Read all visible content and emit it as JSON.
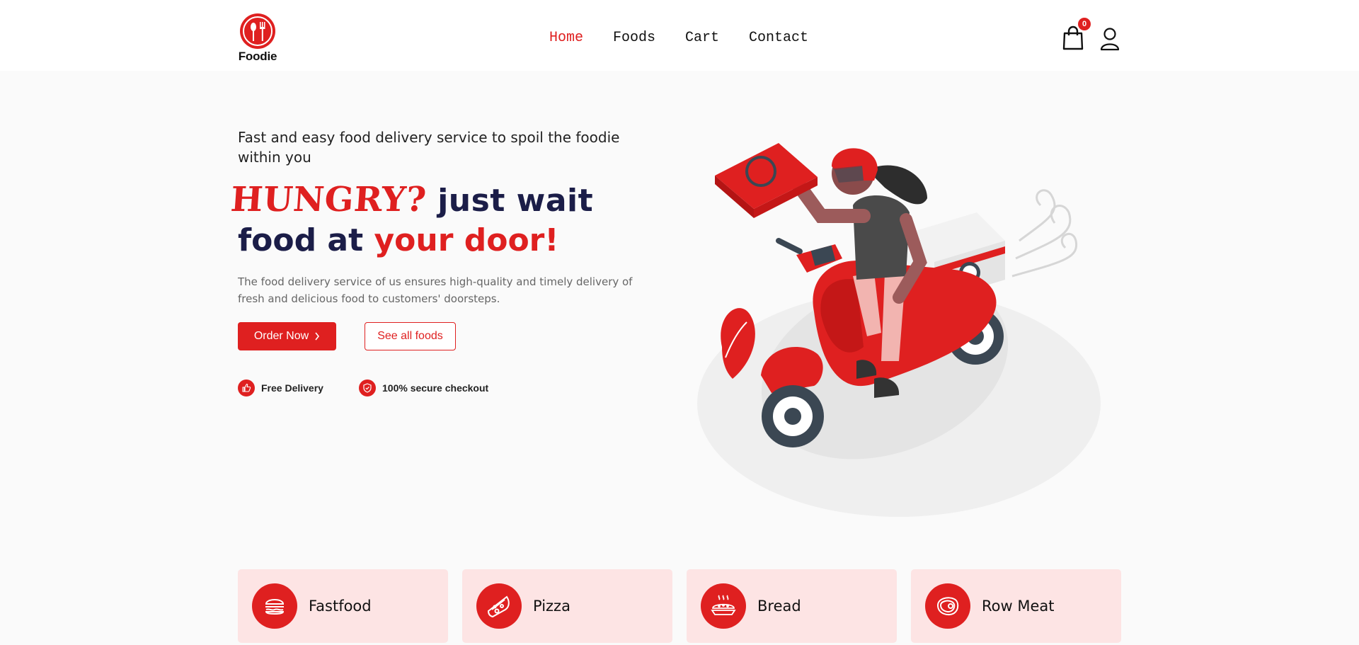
{
  "header": {
    "logo_text": "Foodie",
    "nav": [
      "Home",
      "Foods",
      "Cart",
      "Contact"
    ],
    "active_nav": "Home",
    "cart_count": "0",
    "icons": [
      "shopping-bag-icon",
      "user-icon"
    ]
  },
  "hero": {
    "subtitle": "Fast and easy food delivery service to spoil the foodie within you",
    "headline_part1": "HUNGRY?",
    "headline_part2": "just wait",
    "headline_part3": "food at ",
    "headline_part4": "your door!",
    "description": "The food delivery service of us ensures high-quality and timely delivery of fresh and delicious food to customers' doorsteps.",
    "primary_button": "Order Now",
    "secondary_button": "See all foods",
    "features": [
      {
        "label": "Free Delivery",
        "icon": "thumbs-up-icon"
      },
      {
        "label": "100% secure checkout",
        "icon": "shield-icon"
      }
    ]
  },
  "categories": [
    {
      "label": "Fastfood",
      "icon": "burger-icon"
    },
    {
      "label": "Pizza",
      "icon": "pizza-icon"
    },
    {
      "label": "Bread",
      "icon": "bread-icon"
    },
    {
      "label": "Row Meat",
      "icon": "meat-icon"
    }
  ],
  "colors": {
    "accent": "#df2020",
    "navy": "#1b1d48",
    "card_bg": "#fde4e4",
    "page_bg": "#fafafa"
  }
}
